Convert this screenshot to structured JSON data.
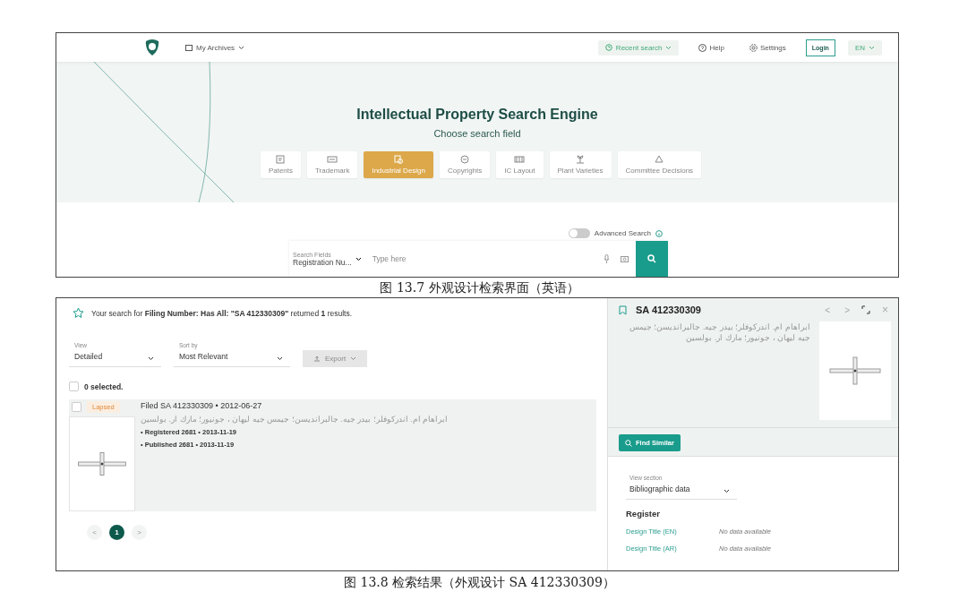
{
  "search_screen": {
    "header": {
      "my_archives": "My Archives",
      "recent_search": "Recent search",
      "help": "Help",
      "settings": "Settings",
      "login": "Login",
      "language": "EN"
    },
    "title": "Intellectual Property Search Engine",
    "subtitle": "Choose search field",
    "categories": [
      {
        "label": "Patents",
        "selected": false
      },
      {
        "label": "Trademark",
        "selected": false
      },
      {
        "label": "Industrial Design",
        "selected": true
      },
      {
        "label": "Copyrights",
        "selected": false
      },
      {
        "label": "IC Layout",
        "selected": false
      },
      {
        "label": "Plant Varieties",
        "selected": false
      },
      {
        "label": "Committee Decisions",
        "selected": false
      }
    ],
    "advanced_search": {
      "label": "Advanced Search",
      "on": false
    },
    "search_bar": {
      "field_label": "Search Fields",
      "field_value": "Registration Nu...",
      "placeholder": "Type here"
    }
  },
  "caption_1": "图 13.7  外观设计检索界面（英语）",
  "results_screen": {
    "summary": "Your search for **Filing Number: Has All: \"SA 412330309\"** returned **1** results.",
    "view": {
      "label": "View",
      "value": "Detailed"
    },
    "sort": {
      "label": "Sort by",
      "value": "Most Relevant"
    },
    "export": {
      "label": "Export",
      "disabled": true
    },
    "select_all": {
      "label": "0 selected.",
      "checked": false
    },
    "results": [
      {
        "checked": false,
        "status": "Lapsed",
        "title": "Filed SA 412330309",
        "separator": "•",
        "date": "2012-06-27",
        "owners": "ابراهام ام. اندركوفلر؛ بيدر جيه. جالبرانديسن؛ جيمس جيه ليهان ، جونيور؛ مارك ار. بولسين",
        "events": [
          "• Registered 2681 • 2013-11-19",
          "• Published 2681 • 2013-11-19"
        ]
      }
    ],
    "pages": [
      {
        "label": "<",
        "kind": "arrow",
        "selected": false
      },
      {
        "label": "1",
        "kind": "page",
        "selected": true
      },
      {
        "label": ">",
        "kind": "arrow",
        "selected": false
      }
    ],
    "detail": {
      "title": "SA 412330309",
      "nav_prev": "<",
      "nav_next": ">",
      "close": "×",
      "owners": "ابراهام ام. اندركوفلر؛ بيدر جيه. جالبرانديسن؛ جيمس جيه ليهان ، جونيور؛ مارك ار. بولسين",
      "find_similar": "Find Similar",
      "view_section": {
        "label": "View section",
        "value": "Bibliographic data"
      },
      "section_title": "Register",
      "fields": [
        {
          "label": "Design Title (EN)",
          "value": "No data available"
        },
        {
          "label": "Design Title (AR)",
          "value": "No data available"
        }
      ]
    }
  },
  "caption_2": "图 13.8  检索结果（外观设计 SA 412330309）"
}
